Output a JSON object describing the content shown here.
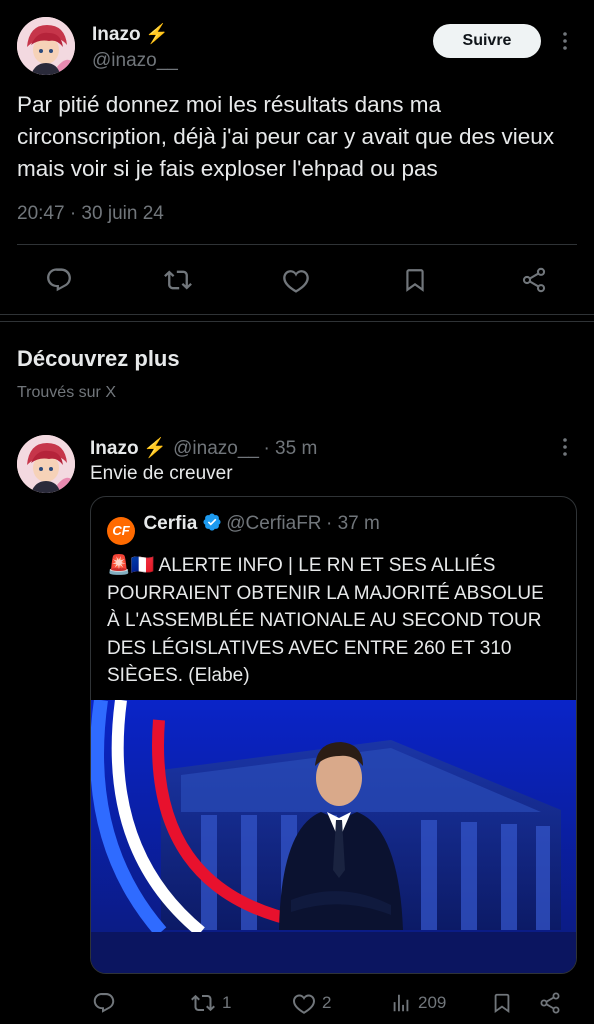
{
  "main_tweet": {
    "author_name": "Inazo",
    "author_emoji": "⚡",
    "author_handle": "@inazo__",
    "follow_label": "Suivre",
    "text": "Par pitié donnez moi les résultats dans ma circonscription, déjà j'ai peur car y avait que des vieux mais voir si je fais exploser l'ehpad ou pas",
    "timestamp": "20:47 · 30 juin 24"
  },
  "discover": {
    "title": "Découvrez plus",
    "subtitle": "Trouvés sur X"
  },
  "reply_tweet": {
    "author_name": "Inazo",
    "author_emoji": "⚡",
    "author_handle": "@inazo__",
    "time": "· 35 m",
    "text": "Envie de creuver",
    "quote": {
      "author_name": "Cerfia",
      "author_handle": "@CerfiaFR",
      "time": "· 37 m",
      "text": "🚨🇫🇷 ALERTE INFO | LE RN ET SES ALLIÉS POURRAIENT OBTENIR LA MAJORITÉ ABSOLUE À L'ASSEMBLÉE NATIONALE AU SECOND TOUR DES LÉGISLATIVES AVEC ENTRE 260 ET 310 SIÈGES. (Elabe)",
      "logo_text": "CF"
    },
    "stats": {
      "reposts": "1",
      "likes": "2",
      "views": "209"
    }
  },
  "colors": {
    "accent": "#1d9bf0",
    "muted": "#71767b",
    "cerfia_orange": "#ff6a00"
  }
}
